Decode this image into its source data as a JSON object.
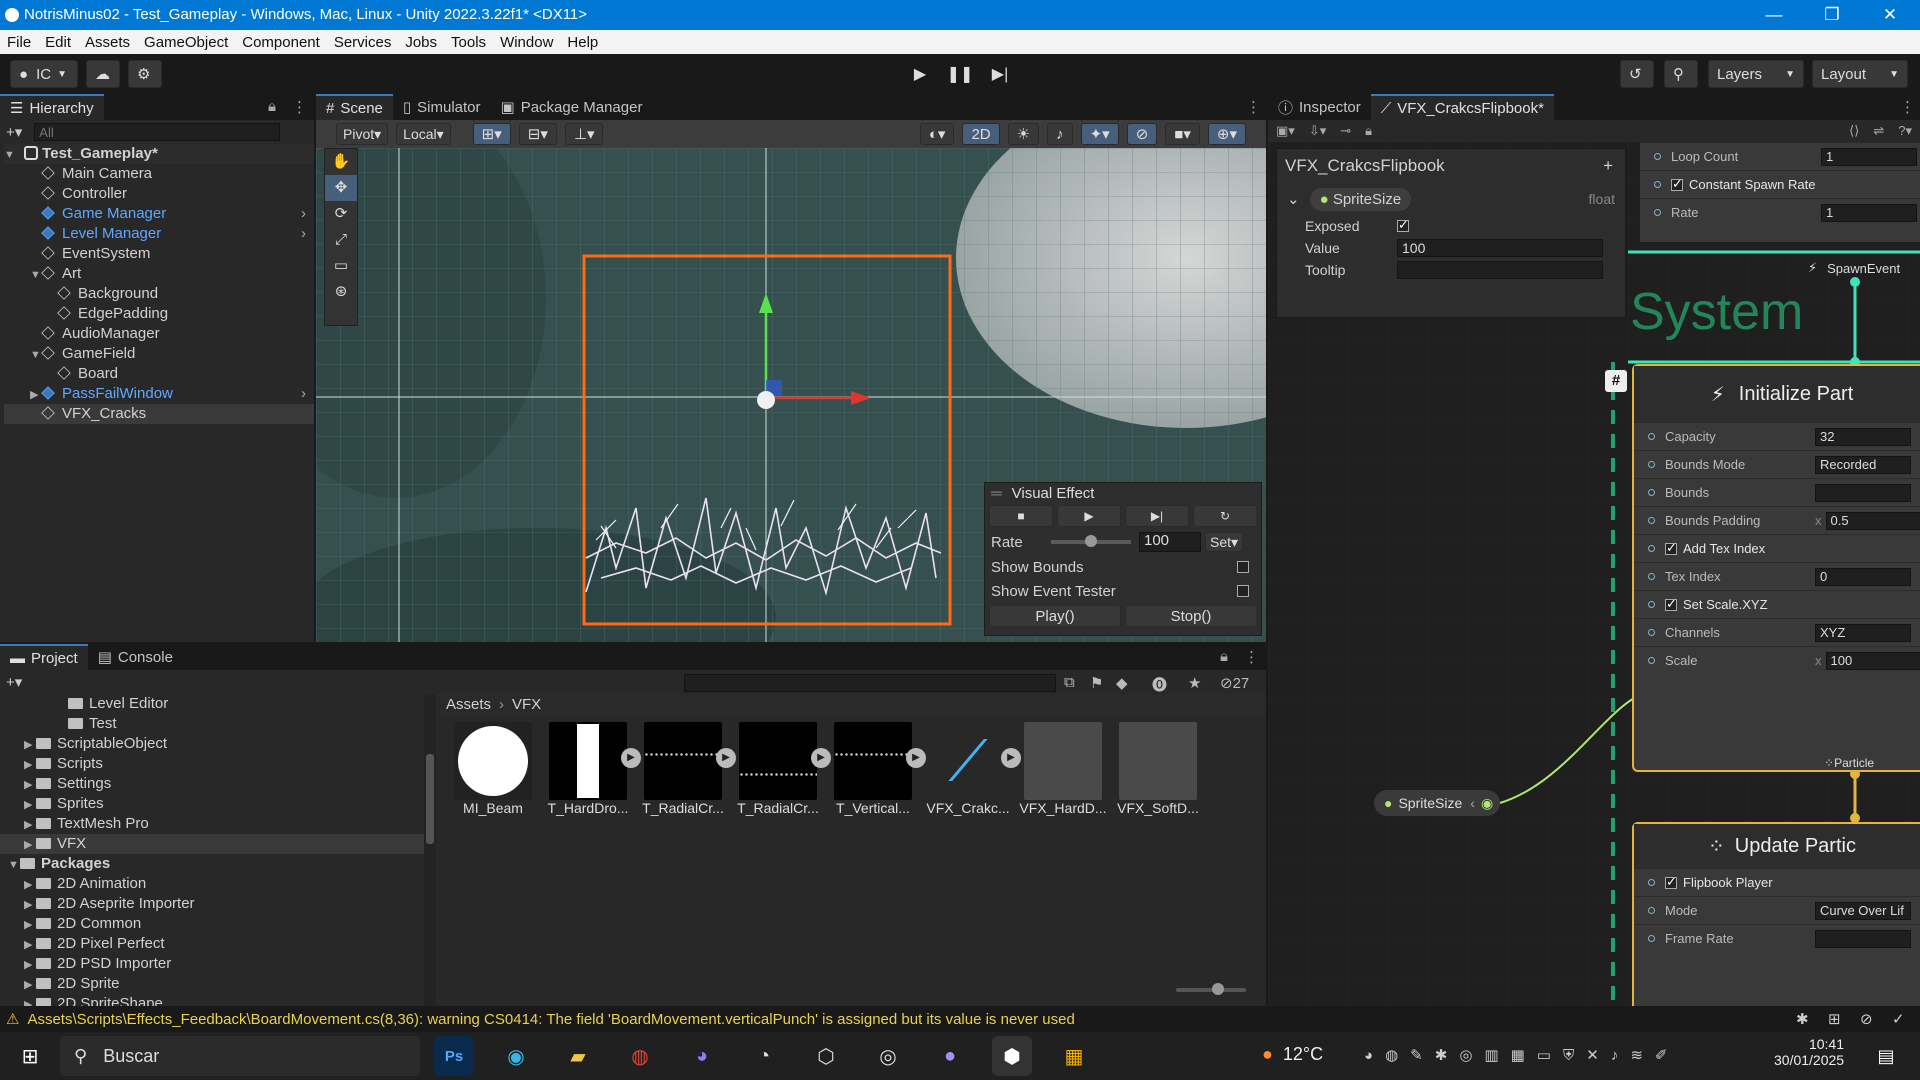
{
  "window": {
    "title": "NotrisMinus02 - Test_Gameplay - Windows, Mac, Linux - Unity 2022.3.22f1* <DX11>"
  },
  "menu": [
    "File",
    "Edit",
    "Assets",
    "GameObject",
    "Component",
    "Services",
    "Jobs",
    "Tools",
    "Window",
    "Help"
  ],
  "toolbar": {
    "account": "IC",
    "layers": "Layers",
    "layout": "Layout"
  },
  "hierarchy": {
    "tab": "Hierarchy",
    "search_placeholder": "All",
    "scene": "Test_Gameplay*",
    "items": [
      {
        "label": "Main Camera",
        "level": 1,
        "prefab": false
      },
      {
        "label": "Controller",
        "level": 1,
        "prefab": false
      },
      {
        "label": "Game Manager",
        "level": 1,
        "prefab": true
      },
      {
        "label": "Level Manager",
        "level": 1,
        "prefab": true
      },
      {
        "label": "EventSystem",
        "level": 1,
        "prefab": false
      },
      {
        "label": "Art",
        "level": 1,
        "prefab": false
      },
      {
        "label": "Background",
        "level": 2,
        "prefab": false
      },
      {
        "label": "EdgePadding",
        "level": 2,
        "prefab": false
      },
      {
        "label": "AudioManager",
        "level": 1,
        "prefab": false
      },
      {
        "label": "GameField",
        "level": 1,
        "prefab": false
      },
      {
        "label": "Board",
        "level": 2,
        "prefab": false
      },
      {
        "label": "PassFailWindow",
        "level": 1,
        "prefab": true
      },
      {
        "label": "VFX_Cracks",
        "level": 1,
        "prefab": false
      }
    ]
  },
  "scene": {
    "tabs": [
      "Scene",
      "Simulator",
      "Package Manager"
    ],
    "pivot": "Pivot",
    "local": "Local",
    "mode2d": "2D",
    "visual_effect": {
      "title": "Visual Effect",
      "rate_label": "Rate",
      "rate_value": "100",
      "rate_level": 0.5,
      "set_label": "Set",
      "show_bounds": "Show Bounds",
      "show_event_tester": "Show Event Tester",
      "play": "Play()",
      "stop": "Stop()"
    }
  },
  "project": {
    "tabs": [
      "Project",
      "Console"
    ],
    "folders": [
      {
        "label": "Level Editor",
        "level": 2
      },
      {
        "label": "Test",
        "level": 2
      },
      {
        "label": "ScriptableObject",
        "level": 1
      },
      {
        "label": "Scripts",
        "level": 1
      },
      {
        "label": "Settings",
        "level": 1
      },
      {
        "label": "Sprites",
        "level": 1
      },
      {
        "label": "TextMesh Pro",
        "level": 1
      },
      {
        "label": "VFX",
        "level": 1
      }
    ],
    "packages_label": "Packages",
    "packages": [
      "2D Animation",
      "2D Aseprite Importer",
      "2D Common",
      "2D Pixel Perfect",
      "2D PSD Importer",
      "2D Sprite",
      "2D SpriteShape"
    ],
    "breadcrumb": [
      "Assets",
      "VFX"
    ],
    "hidden_count": "27",
    "assets": [
      {
        "label": "MI_Beam",
        "kind": "circle"
      },
      {
        "label": "T_HardDro...",
        "kind": "bar"
      },
      {
        "label": "T_RadialCr...",
        "kind": "noise"
      },
      {
        "label": "T_RadialCr...",
        "kind": "noise2"
      },
      {
        "label": "T_Vertical...",
        "kind": "noise"
      },
      {
        "label": "VFX_Crakc...",
        "kind": "vfx"
      },
      {
        "label": "VFX_HardD...",
        "kind": "gray"
      },
      {
        "label": "VFX_SoftD...",
        "kind": "gray"
      }
    ]
  },
  "inspector": {
    "tabs": [
      "Inspector",
      "VFX_CrakcsFlipbook*"
    ],
    "asset_name": "VFX_CrakcsFlipbook",
    "property": {
      "name": "SpriteSize",
      "type": "float",
      "exposed_label": "Exposed",
      "value_label": "Value",
      "value": "100",
      "tooltip_label": "Tooltip"
    }
  },
  "graph": {
    "system_label": "System",
    "spawn_rows": [
      {
        "label": "Loop Count",
        "value": "1"
      },
      {
        "label": "Constant Spawn Rate",
        "check": true
      },
      {
        "label": "Rate",
        "value": "1"
      }
    ],
    "spawn_event": "SpawnEvent",
    "initialize_title": "Initialize Part",
    "initialize_rows": [
      {
        "label": "Capacity",
        "value": "32"
      },
      {
        "label": "Bounds Mode",
        "value": "Recorded"
      },
      {
        "label": "Bounds",
        "value": ""
      },
      {
        "label": "Bounds Padding",
        "value": "0.5",
        "prefix": "x"
      },
      {
        "label": "Add Tex Index",
        "check": true
      },
      {
        "label": "Tex Index",
        "value": "0"
      },
      {
        "label": "Set Scale.XYZ",
        "check": true
      },
      {
        "label": "Channels",
        "value": "XYZ"
      },
      {
        "label": "Scale",
        "value": "100",
        "prefix": "x"
      }
    ],
    "particle_label": "Particle",
    "sprite_size_node": "SpriteSize",
    "update_title": "Update Partic",
    "update_rows": [
      {
        "label": "Flipbook Player",
        "check": true
      },
      {
        "label": "Mode",
        "value": "Curve Over Lif"
      },
      {
        "label": "Frame Rate",
        "value": ""
      }
    ]
  },
  "status_bar": "Assets\\Scripts\\Effects_Feedback\\BoardMovement.cs(8,36): warning CS0414: The field 'BoardMovement.verticalPunch' is assigned but its value is never used",
  "taskbar": {
    "search": "Buscar",
    "weather": "12°C",
    "time": "10:41",
    "date": "30/01/2025"
  }
}
